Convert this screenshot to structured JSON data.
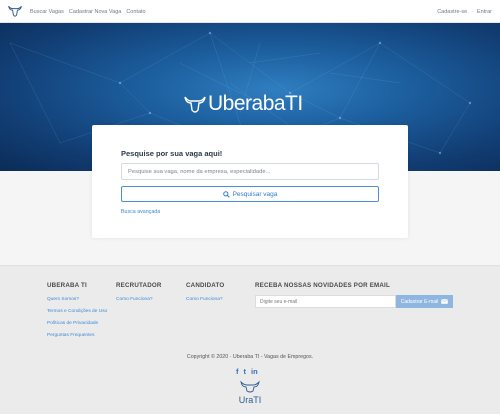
{
  "nav": {
    "logo_icon": "bull-head-icon",
    "links": [
      "Buscar Vagas",
      "Cadastrar Nova Vaga",
      "Contato"
    ],
    "register": "Cadastre-se",
    "separator": "·",
    "login": "Entrar"
  },
  "hero": {
    "brand": "UberabaTI",
    "logo_icon": "bull-head-icon"
  },
  "search": {
    "title": "Pesquise por sua vaga aqui!",
    "placeholder": "Pesquise sua vaga, nome da empresa, especialidade...",
    "button_label": "Pesquisar vaga",
    "button_icon": "search-icon",
    "advanced_link": "Busca avançada"
  },
  "footer": {
    "col1": {
      "title": "UBERABA TI",
      "links": [
        "Quem Somos?",
        "Termos e Condições de Uso",
        "Políticas de Privacidade",
        "Perguntas Frequentes"
      ]
    },
    "col2": {
      "title": "RECRUTADOR",
      "links": [
        "Como Funciona?"
      ]
    },
    "col3": {
      "title": "CANDIDATO",
      "links": [
        "Como Funciona?"
      ]
    },
    "newsletter": {
      "title": "RECEBA NOSSAS NOVIDADES POR EMAIL",
      "placeholder": "Digite seu e-mail",
      "button_label": "Cadastrar E-mail",
      "button_icon": "envelope-icon"
    },
    "copyright": "Copyright © 2020 · Uberaba TI - Vagas de Empregos.",
    "social": [
      "f",
      "t",
      "in"
    ],
    "logo_text": "UraTI"
  },
  "colors": {
    "hero_dark": "#0b2c57",
    "hero_light": "#2f7ec0",
    "link": "#3d8ad8",
    "footer_bg": "#ebebeb"
  }
}
